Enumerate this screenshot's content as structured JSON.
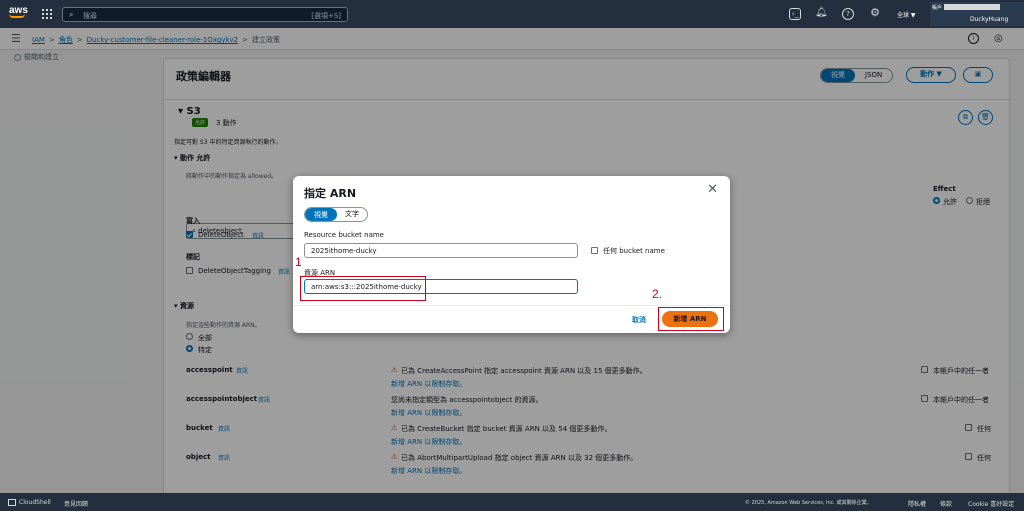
{
  "topbar": {
    "logo": "aws",
    "search_placeholder": "搜尋",
    "search_shortcut": "[選項+S]",
    "region": "全球 ▼",
    "account_label": "帳戶",
    "user": "DuckyHuang"
  },
  "breadcrumb": {
    "items": [
      "IAM",
      "角色",
      "Ducky-customer-file-cleaner-role-1Oxgykv2",
      "建立政策"
    ],
    "separator": ">"
  },
  "steps": {
    "step_label": "檢閱和建立"
  },
  "editor": {
    "title": "政策編輯器",
    "tab_visual": "視覺",
    "tab_json": "JSON",
    "actions_label": "動作 ▼"
  },
  "service": {
    "name": "S3",
    "badge": "允許",
    "action_count": "3 動作",
    "desc": "指定可對 S3 中的特定資源執行的動作。",
    "actions_heading": "動作 允許",
    "actions_subtext": "將動作中的動作指定為 allowed。",
    "filter_value": "deleteobject",
    "effect_label": "Effect",
    "effect_allow": "允許",
    "effect_deny": "拒絕",
    "write_group": "寫入",
    "write_item": "DeleteObject",
    "info": "資訊",
    "tag_group": "標記",
    "tag_item": "DeleteObjectTagging",
    "resources_heading": "資源",
    "resources_sub": "指定這些動作的資源 ARN。",
    "res_all": "全部",
    "res_specific": "特定",
    "resource_rows": [
      {
        "name": "accesspoint",
        "line1": "已為 CreateAccessPoint 指定 accesspoint 資源 ARN 以及 15 個更多動作。",
        "line2": "新增 ARN 以限制存取。",
        "right": "本帳戶中的任一者"
      },
      {
        "name": "accesspointobject",
        "line1": "您尚未指定類型為 accesspointobject 的資源。",
        "line2": "新增 ARN 以限制存取。",
        "right": "本帳戶中的任一者"
      },
      {
        "name": "bucket",
        "line1": "已為 CreateBucket 指定 bucket 資源 ARN 以及 54 個更多動作。",
        "line2": "新增 ARN 以限制存取。",
        "right": "任何"
      },
      {
        "name": "object",
        "line1": "已為 AbortMultipartUpload 指定 object 資源 ARN 以及 32 個更多動作。",
        "line2": "新增 ARN 以限制存取。",
        "right": "任何"
      }
    ]
  },
  "modal": {
    "title": "指定 ARN",
    "tab_visual": "視覺",
    "tab_text": "文字",
    "bucket_label": "Resource bucket name",
    "bucket_value": "2025ithome-ducky",
    "any_bucket_label": "任何 bucket name",
    "arn_label": "資源 ARN",
    "arn_value": "arn:aws:s3:::2025ithome-ducky",
    "cancel": "取消",
    "add": "新增 ARN"
  },
  "annotations": {
    "num1": "1",
    "num2": "2."
  },
  "footer": {
    "cloudshell": "CloudShell",
    "feedback": "意見回饋",
    "copyright": "© 2025, Amazon Web Services, Inc. 或其關係企業。",
    "privacy": "隱私權",
    "terms": "條款",
    "cookie": "Cookie 喜好設定"
  },
  "colors": {
    "accent": "#0073bb",
    "primary_button": "#ec7211",
    "annotation": "#d0021b",
    "nav": "#232f3e"
  }
}
